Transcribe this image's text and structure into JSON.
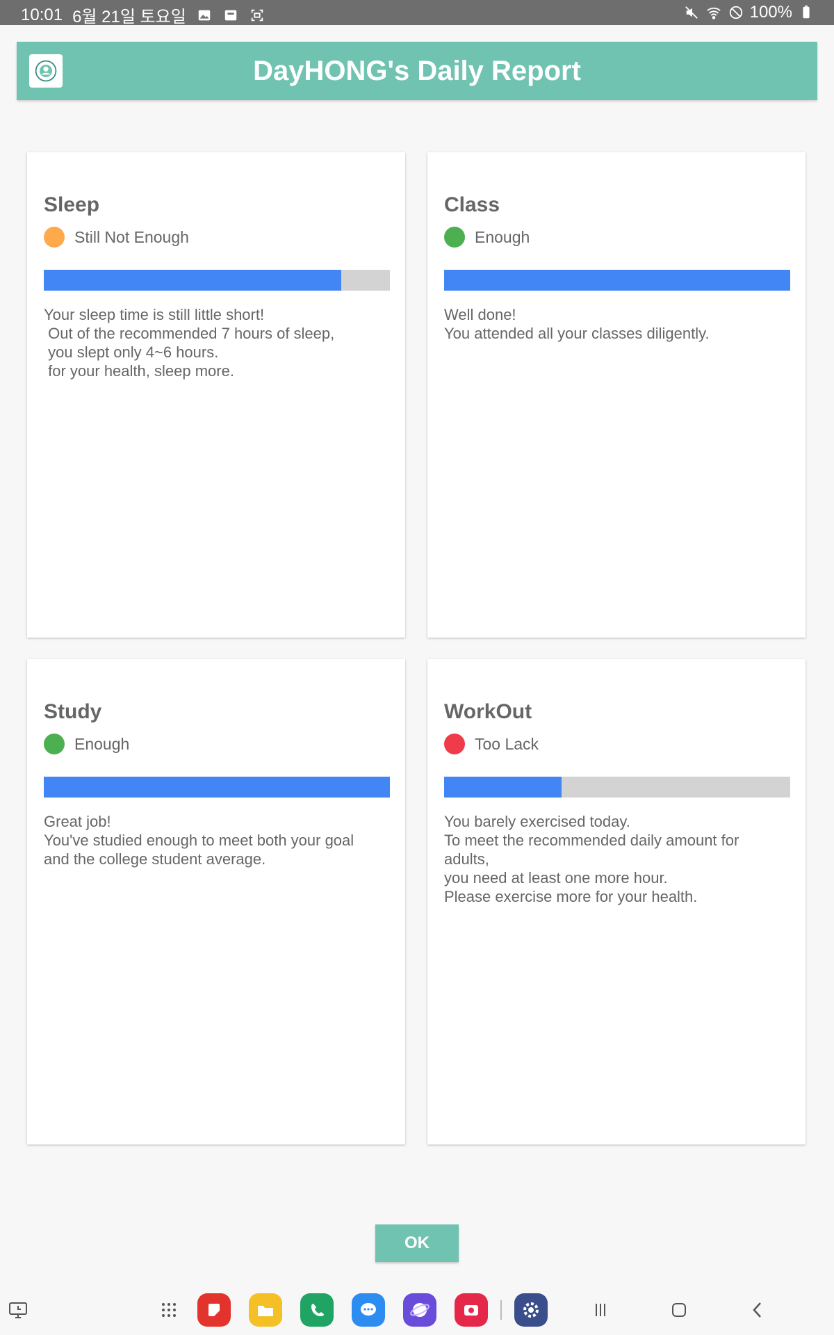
{
  "status_bar": {
    "time": "10:01",
    "date": "6월 21일 토요일",
    "battery": "100%",
    "icons_left": [
      "gallery-icon",
      "notification-icon",
      "screenshot-icon"
    ],
    "icons_right": [
      "mute-icon",
      "wifi-icon",
      "do-not-disturb-icon",
      "battery-icon"
    ]
  },
  "header": {
    "title": "DayHONG's Daily Report",
    "logo_icon": "app-logo-icon",
    "color": "#71c3b1"
  },
  "cards": [
    {
      "title": "Sleep",
      "status": "Still Not Enough",
      "status_color": "#ffa94d",
      "progress": 0.86,
      "description": "Your sleep time is still little short!\n Out of the recommended 7 hours of sleep,\n you slept only 4~6 hours.\n for your health, sleep more."
    },
    {
      "title": "Class",
      "status": "Enough",
      "status_color": "#4caf50",
      "progress": 1.0,
      "description": "Well done!\nYou attended all your classes diligently."
    },
    {
      "title": "Study",
      "status": "Enough",
      "status_color": "#4caf50",
      "progress": 1.0,
      "description": "Great job!\nYou've studied enough to meet both your goal\nand the college student average."
    },
    {
      "title": "WorkOut",
      "status": "Too Lack",
      "status_color": "#ef3b4a",
      "progress": 0.34,
      "description": "You barely exercised today.\nTo meet the recommended daily amount for\nadults,\nyou need at least one more hour.\nPlease exercise more for your health."
    }
  ],
  "ok_button": {
    "label": "OK"
  },
  "colors": {
    "progress_fill": "#4285f4",
    "progress_track": "#d3d3d3"
  },
  "taskbar": {
    "icons": [
      "recent-screen-icon",
      "app-drawer-icon",
      "samsung-notes-icon",
      "my-files-icon",
      "phone-icon",
      "messages-icon",
      "internet-icon",
      "camera-icon",
      "settings-icon",
      "recents-nav-icon",
      "home-nav-icon",
      "back-nav-icon"
    ]
  }
}
